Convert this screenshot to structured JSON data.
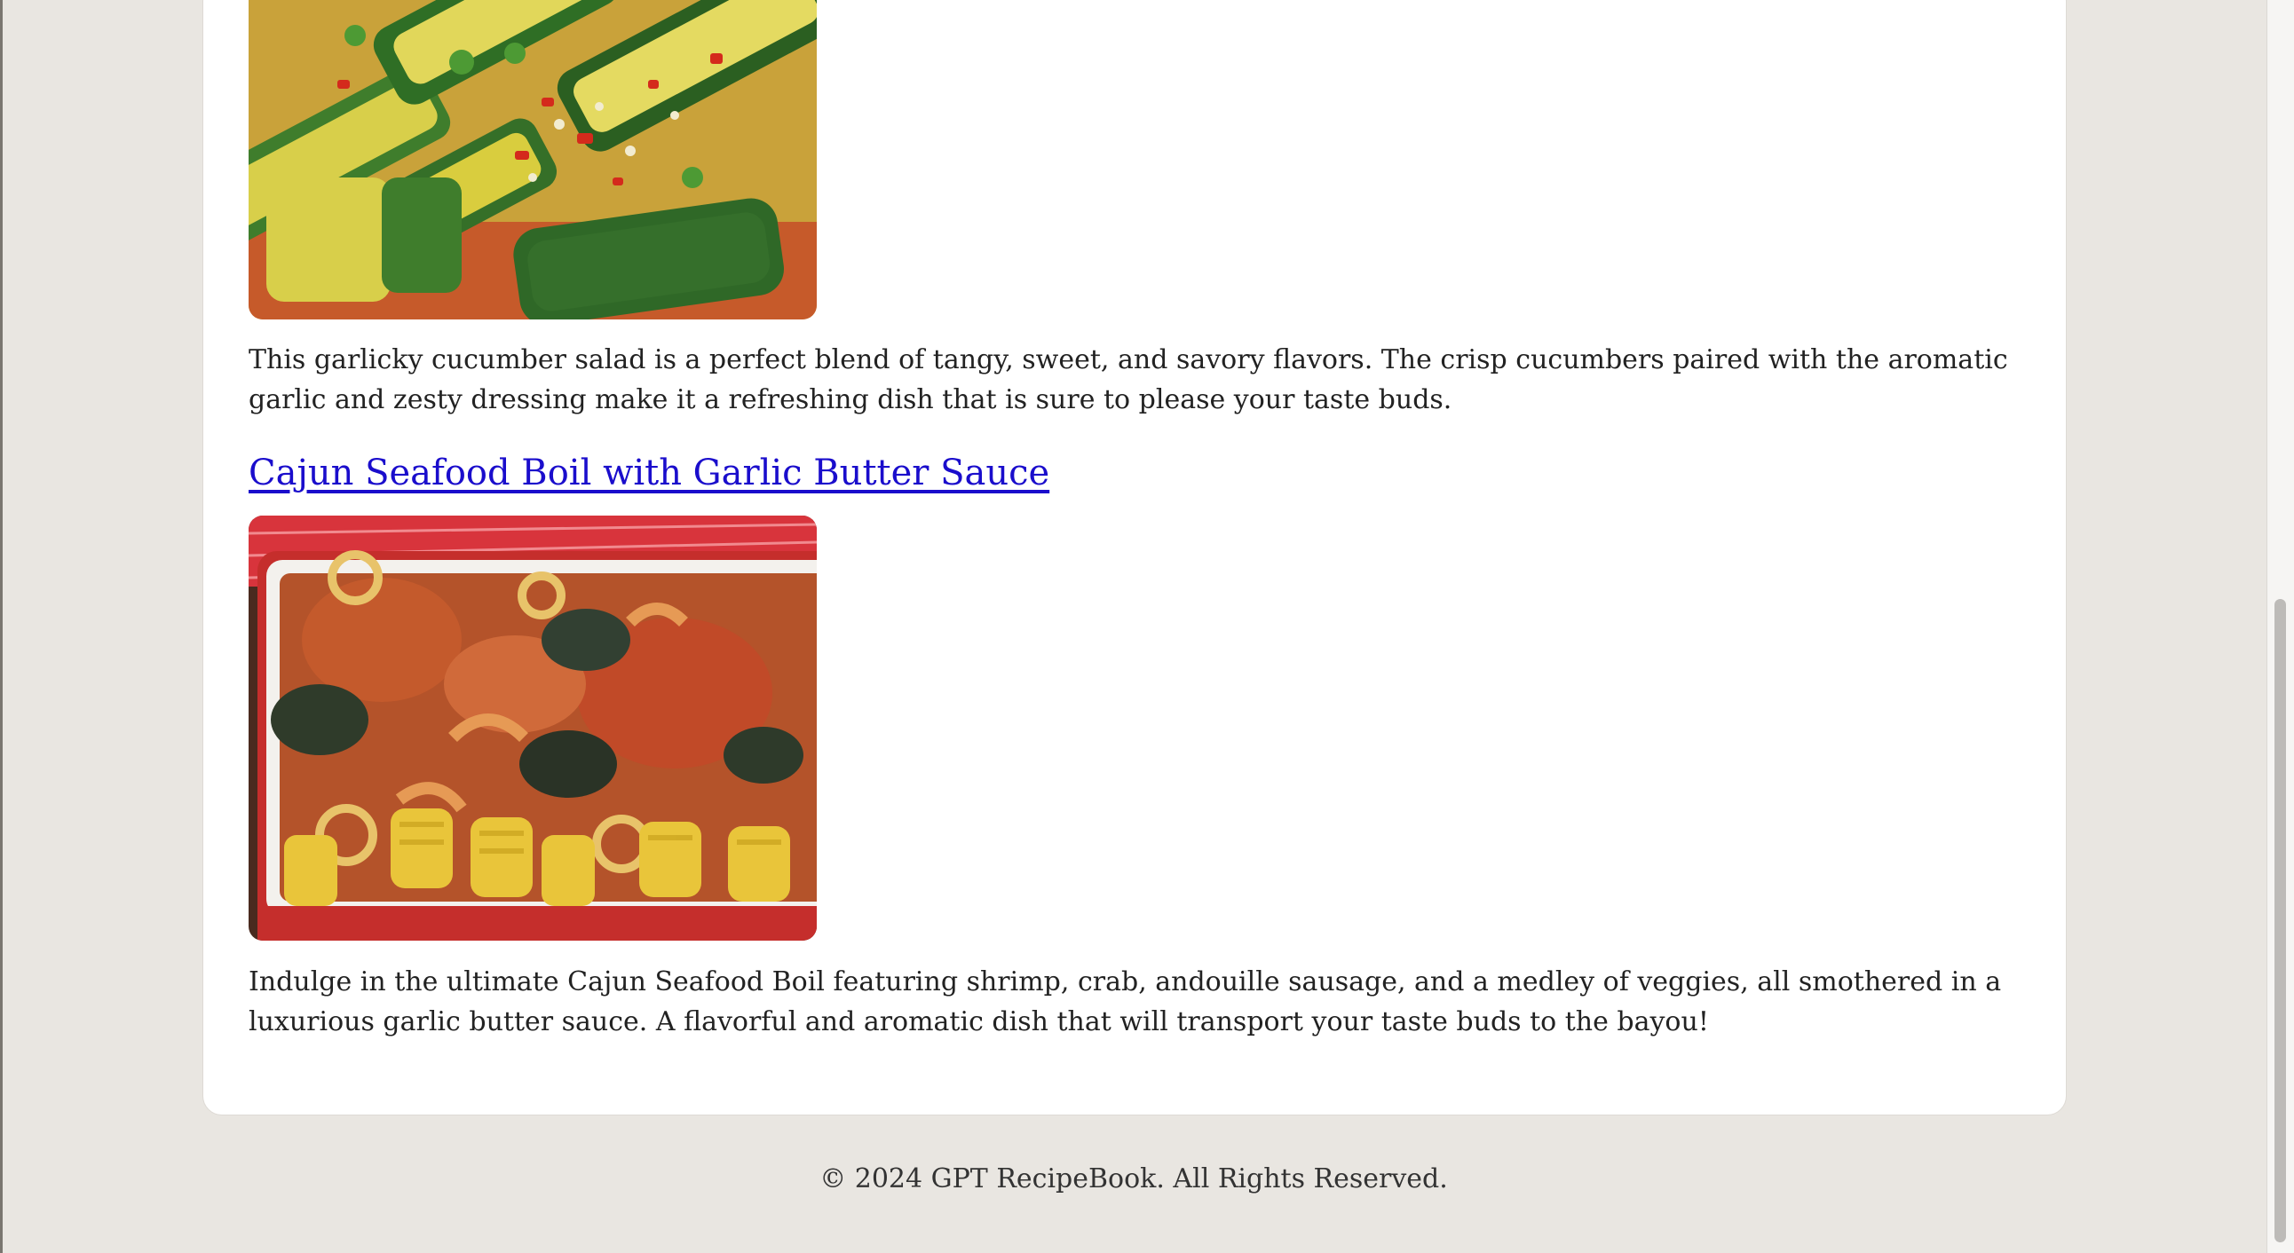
{
  "recipes": [
    {
      "title": "",
      "image_alt": "Garlicky cucumber salad",
      "description": "This garlicky cucumber salad is a perfect blend of tangy, sweet, and savory flavors. The crisp cucumbers paired with the aromatic garlic and zesty dressing make it a refreshing dish that is sure to please your taste buds."
    },
    {
      "title": "Cajun Seafood Boil with Garlic Butter Sauce",
      "image_alt": "Cajun seafood boil with crab, shrimp, mussels and corn",
      "description": "Indulge in the ultimate Cajun Seafood Boil featuring shrimp, crab, andouille sausage, and a medley of veggies, all smothered in a luxurious garlic butter sauce. A flavorful and aromatic dish that will transport your taste buds to the bayou!"
    }
  ],
  "footer": {
    "copyright": "© 2024 GPT RecipeBook. All Rights Reserved."
  },
  "colors": {
    "page_bg": "#e9e6e1",
    "card_bg": "#ffffff",
    "link": "#1a0dcc",
    "text": "#222222"
  }
}
